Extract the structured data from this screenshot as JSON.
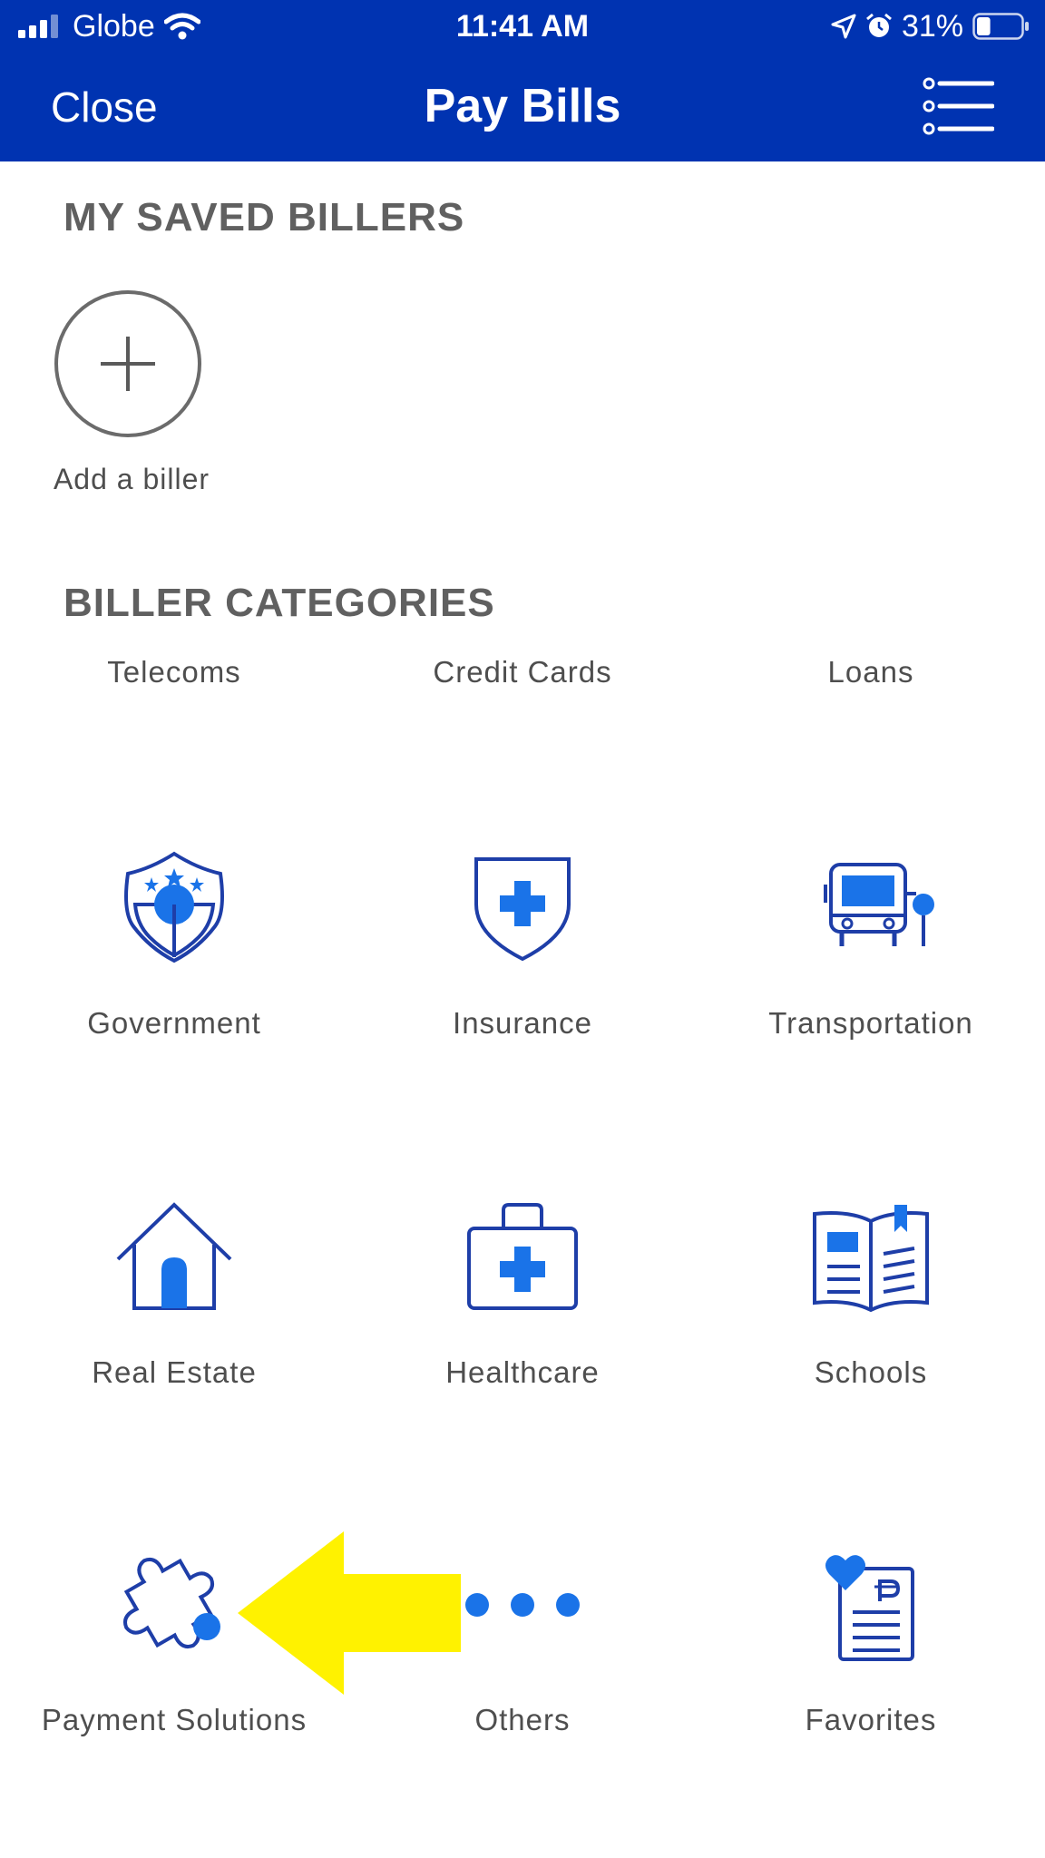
{
  "status_bar": {
    "carrier": "Globe",
    "time": "11:41 AM",
    "battery": "31%",
    "battery_level": 0.31
  },
  "header": {
    "close_label": "Close",
    "title": "Pay Bills",
    "menu_icon": "list-menu-icon"
  },
  "saved_billers": {
    "title": "MY SAVED BILLERS",
    "add_label": "Add a biller"
  },
  "categories": {
    "title": "BILLER CATEGORIES",
    "items": [
      {
        "label": "Telecoms",
        "icon": ""
      },
      {
        "label": "Credit Cards",
        "icon": ""
      },
      {
        "label": "Loans",
        "icon": ""
      },
      {
        "label": "Government",
        "icon": "government-badge-icon"
      },
      {
        "label": "Insurance",
        "icon": "insurance-shield-icon"
      },
      {
        "label": "Transportation",
        "icon": "bus-icon"
      },
      {
        "label": "Real Estate",
        "icon": "house-icon"
      },
      {
        "label": "Healthcare",
        "icon": "medical-kit-icon"
      },
      {
        "label": "Schools",
        "icon": "book-icon"
      },
      {
        "label": "Payment Solutions",
        "icon": "puzzle-icon"
      },
      {
        "label": "Others",
        "icon": "ellipsis-dots-icon"
      },
      {
        "label": "Favorites",
        "icon": "favorite-bill-icon"
      }
    ]
  },
  "colors": {
    "brand_blue": "#0033b1",
    "icon_blue": "#1a73e8",
    "icon_dark_blue": "#1e3ea8",
    "arrow_yellow": "#fff200",
    "heading_gray": "#606060"
  }
}
